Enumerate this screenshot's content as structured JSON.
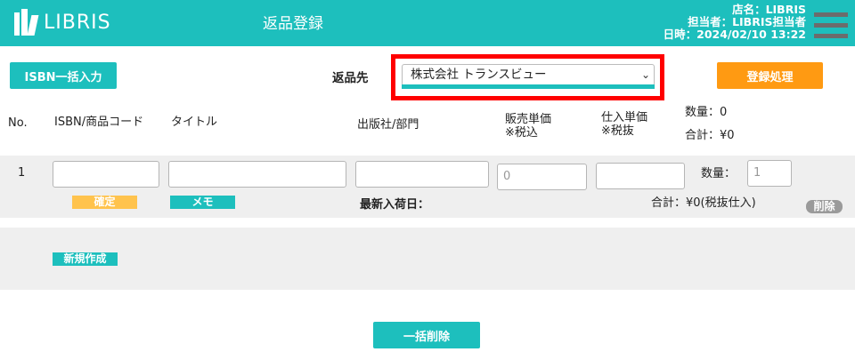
{
  "header": {
    "logo_text": "LIBRIS",
    "page_title": "返品登録",
    "store": "店名：LIBRIS",
    "staff": "担当者：LIBRIS担当者",
    "datetime": "日時：2024/02/10  13:22"
  },
  "toolbar": {
    "isbn_bulk_label": "ISBN一括入力",
    "return_destination_label": "返品先",
    "return_destination_value": "株式会社 トランスビュー",
    "register_label": "登録処理"
  },
  "columns": {
    "no": "No.",
    "isbn": "ISBN/商品コード",
    "title": "タイトル",
    "publisher": "出版社/部門",
    "retail_price": "販売単価",
    "retail_note": "※税込",
    "cost_price": "仕入単価",
    "cost_note": "※税抜",
    "quantity_total": "数量：0",
    "amount_total": "合計：¥0"
  },
  "rows": [
    {
      "no": "1",
      "retail_price_value": "0",
      "quantity_label": "数量：",
      "quantity_value": "1",
      "confirm_label": "確定",
      "memo_label": "メモ",
      "latest_arrival_label": "最新入荷日：",
      "subtotal": "合計：¥0(税抜仕入)",
      "delete_label": "削除"
    }
  ],
  "new_label": "新規作成",
  "bulk_delete_label": "一括削除",
  "colors": {
    "brand": "#1dbfbd",
    "accent": "#ff9a12",
    "confirm": "#ffc34d",
    "highlight": "#ff0000"
  }
}
